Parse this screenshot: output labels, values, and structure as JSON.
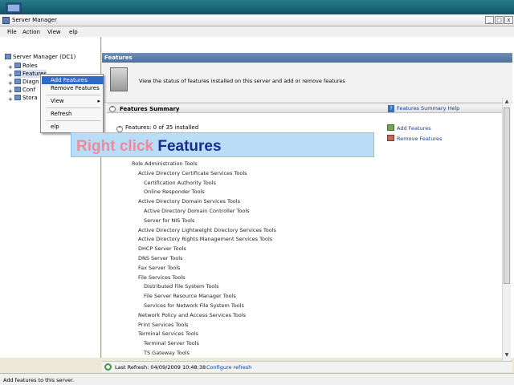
{
  "window": {
    "title": "Server Manager"
  },
  "menu": {
    "file": "File",
    "action": "Action",
    "view": "View",
    "help": "elp"
  },
  "tree": {
    "root": "Server Manager (DC1)",
    "items": [
      "Roles",
      "Features",
      "Diagn",
      "Conf",
      "Stora"
    ]
  },
  "context_menu": {
    "items": [
      "Add Features",
      "Remove Features",
      "View",
      "Refresh",
      "elp"
    ],
    "submenu_arrow": "▸"
  },
  "pane": {
    "header": "Features",
    "intro": "View the status of features installed on this server and add or remove features",
    "summary_title": "Features Summary",
    "help_link": "Features Summary Help",
    "features_count": "Features: 0 of 35 installed",
    "add_features": "Add Features",
    "remove_features": "Remove Features"
  },
  "feature_list": [
    {
      "text": "Role Administration Tools",
      "indent": 0
    },
    {
      "text": "Active Directory Certificate Services Tools",
      "indent": 1
    },
    {
      "text": "Certification Authority Tools",
      "indent": 2
    },
    {
      "text": "Online Responder Tools",
      "indent": 2
    },
    {
      "text": "Active Directory Domain Services Tools",
      "indent": 1
    },
    {
      "text": "Active Directory Domain Controller Tools",
      "indent": 2
    },
    {
      "text": "Server for NIS Tools",
      "indent": 2
    },
    {
      "text": "Active Directory Lightweight Directory Services Tools",
      "indent": 1
    },
    {
      "text": "Active Directory Rights Management Services Tools",
      "indent": 1
    },
    {
      "text": "DHCP Server Tools",
      "indent": 1
    },
    {
      "text": "DNS Server Tools",
      "indent": 1
    },
    {
      "text": "Fax Server Tools",
      "indent": 1
    },
    {
      "text": "File Services Tools",
      "indent": 1
    },
    {
      "text": "Distributed File System Tools",
      "indent": 2
    },
    {
      "text": "File Server Resource Manager Tools",
      "indent": 2
    },
    {
      "text": "Services for Network File System Tools",
      "indent": 2
    },
    {
      "text": "Network Policy and Access Services Tools",
      "indent": 1
    },
    {
      "text": "Print Services Tools",
      "indent": 1
    },
    {
      "text": "Terminal Services Tools",
      "indent": 1
    },
    {
      "text": "Terminal Server Tools",
      "indent": 2
    },
    {
      "text": "TS Gateway Tools",
      "indent": 2
    }
  ],
  "bottom": {
    "last_refresh": "Last Refresh: 04/09/2009 10:48:38",
    "configure": "Configure refresh"
  },
  "status": {
    "text": "Add features to this server."
  },
  "callout": {
    "part1": "Right click",
    "part2": "Features"
  },
  "colors": {
    "callout_bg": "#b9dcf7",
    "callout_accent": "#ef8a9a",
    "callout_strong": "#1c2c8c",
    "selection": "#316ac5"
  }
}
